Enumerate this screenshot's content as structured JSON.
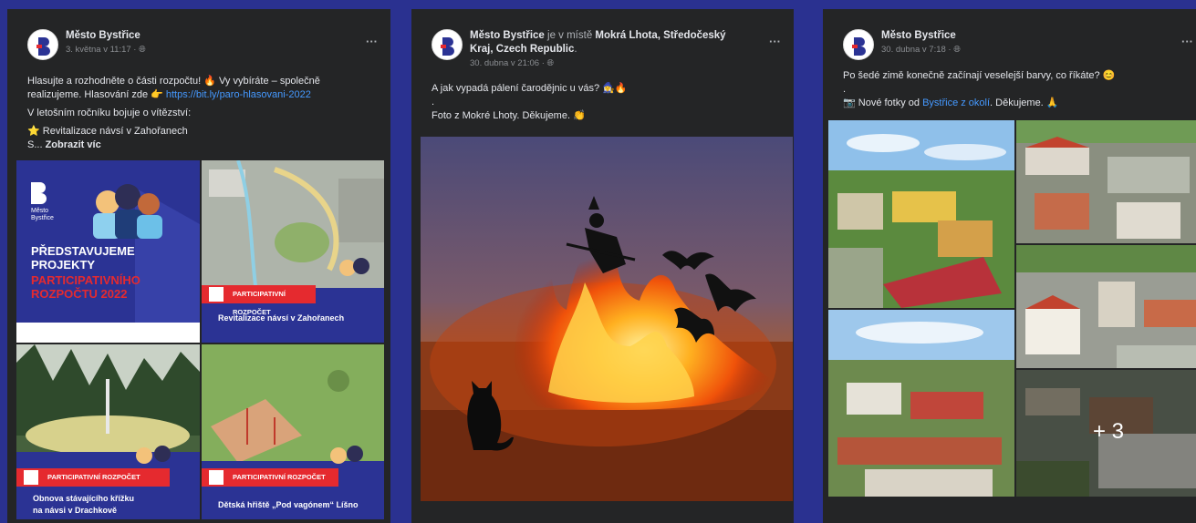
{
  "posts": [
    {
      "author": "Město Bystřice",
      "date": "3. května v 11:17 · ",
      "text": {
        "line1": "Hlasujte a rozhodněte o části rozpočtu! 🔥 Vy vybíráte – společně realizujeme. Hlasování zde 👉 ",
        "link": "https://bit.ly/paro-hlasovani-2022",
        "line2": "V letošním ročníku bojuje o vítězství:",
        "line3": "⭐ Revitalizace návsí v Zahořanech",
        "line4_prefix": "S... ",
        "see_more": "Zobrazit víc"
      },
      "images": {
        "logo_text": "Město\nBystřice",
        "headline": "PŘEDSTAVUJEME\nPROJEKTY",
        "headline_red": "PARTICIPATIVNÍHO\nROZPOČTU 2022",
        "badge_label": "PARTICIPATIVNÍ ROZPOČET",
        "captions": [
          "Revitalizace návsí v Zahořanech",
          "Obnova stávajícího křížku\nna návsi v Drachkově",
          "Dětská hřiště „Pod vagónem“ Líšno"
        ]
      }
    },
    {
      "author": "Město Bystřice",
      "author_suffix": " je v místě ",
      "place": "Mokrá Lhota, Středočeský Kraj, Czech Republic",
      "place_suffix": ".",
      "date": "30. dubna v 21:06 · ",
      "text": {
        "line1": "A jak vypadá pálení čarodějnic u vás? 🧙‍♀️🔥",
        "line2": ".",
        "line3": "Foto z Mokré Lhoty. Děkujeme. 👏"
      }
    },
    {
      "author": "Město Bystřice",
      "date": "30. dubna v 7:18 · ",
      "text": {
        "line1": "Po šedé zimě konečně začínají veselejší barvy, co říkáte? 😊",
        "line2": ".",
        "line3_prefix": "📷 Nové fotky od ",
        "line3_link": "Bystřice z okolí",
        "line3_suffix": ". Děkujeme. 🙏"
      },
      "more_count": "+ 3"
    }
  ],
  "icons": [
    "more-dots-icon",
    "globe-icon",
    "town-logo-icon",
    "fire-emoji",
    "bat-icon",
    "witch-icon",
    "cat-icon"
  ],
  "colors": {
    "background": "#2a3190",
    "card": "#242526",
    "text": "#e4e6eb",
    "muted": "#8a8d91",
    "link": "#4599ff",
    "badge_red": "#e52a2f",
    "promo_blue": "#2b3394"
  }
}
